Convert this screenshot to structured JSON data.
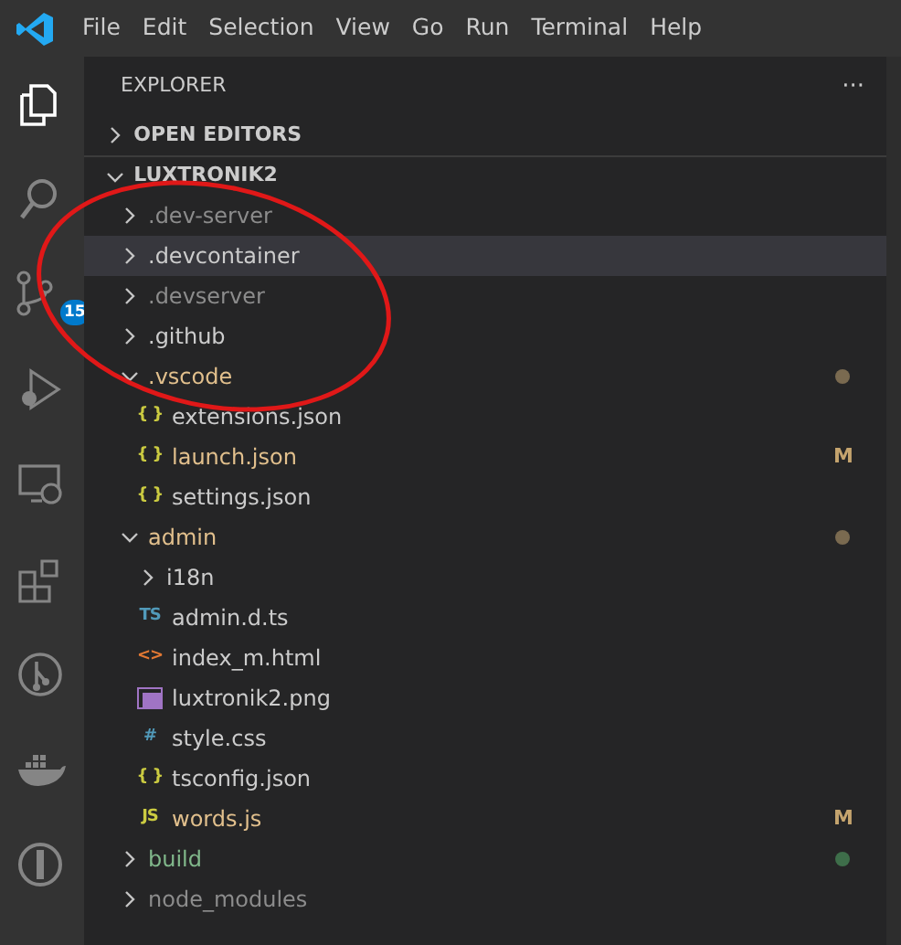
{
  "menu_bar": {
    "items": [
      "File",
      "Edit",
      "Selection",
      "View",
      "Go",
      "Run",
      "Terminal",
      "Help"
    ]
  },
  "activity_bar": [
    {
      "kind": "explorer",
      "selected": true
    },
    {
      "kind": "search",
      "selected": false
    },
    {
      "kind": "source-control",
      "selected": false,
      "badge": "15"
    },
    {
      "kind": "debug",
      "selected": false
    },
    {
      "kind": "remote",
      "selected": false
    },
    {
      "kind": "extensions",
      "selected": false
    },
    {
      "kind": "git-graph",
      "selected": false
    },
    {
      "kind": "docker",
      "selected": false
    },
    {
      "kind": "timeline",
      "selected": false
    }
  ],
  "sidebar": {
    "title": "EXPLORER",
    "more": "···",
    "sections": [
      {
        "title": "OPEN EDITORS",
        "expanded": false
      },
      {
        "title": "LUXTRONIK2",
        "expanded": true
      }
    ]
  },
  "tree": [
    {
      "name": ".dev-server",
      "kind": "folder",
      "expanded": false,
      "selected": false,
      "ignored": true
    },
    {
      "name": ".devcontainer",
      "kind": "folder",
      "expanded": false,
      "selected": true,
      "ignored": false
    },
    {
      "name": ".devserver",
      "kind": "folder",
      "expanded": false,
      "selected": false,
      "ignored": true
    },
    {
      "name": ".github",
      "kind": "folder",
      "expanded": false,
      "selected": false,
      "ignored": false
    },
    {
      "name": ".vscode",
      "kind": "folder",
      "expanded": true,
      "selected": false,
      "ignored": false,
      "color": "#e2c08d",
      "dot": {
        "color": "#7a6a50"
      },
      "children": [
        {
          "name": "extensions.json",
          "kind": "json",
          "icon": "{ }",
          "selected": false,
          "ignored": false
        },
        {
          "name": "launch.json",
          "kind": "json",
          "icon": "{ }",
          "selected": false,
          "ignored": false,
          "color": "#e2c08d",
          "status": "M"
        },
        {
          "name": "settings.json",
          "kind": "json",
          "icon": "{ }",
          "selected": false,
          "ignored": false
        }
      ]
    },
    {
      "name": "admin",
      "kind": "folder",
      "expanded": true,
      "selected": false,
      "ignored": false,
      "color": "#e2c08d",
      "dot": {
        "color": "#7a6a50"
      },
      "children": [
        {
          "name": "i18n",
          "kind": "folder",
          "expanded": false,
          "selected": false,
          "ignored": false
        },
        {
          "name": "admin.d.ts",
          "kind": "ts",
          "icon": "TS",
          "selected": false,
          "ignored": false
        },
        {
          "name": "index_m.html",
          "kind": "html",
          "icon": "<>",
          "selected": false,
          "ignored": false
        },
        {
          "name": "luxtronik2.png",
          "kind": "image",
          "selected": false,
          "ignored": false
        },
        {
          "name": "style.css",
          "kind": "css",
          "icon": "#",
          "selected": false,
          "ignored": false
        },
        {
          "name": "tsconfig.json",
          "kind": "json",
          "icon": "{ }",
          "selected": false,
          "ignored": false
        },
        {
          "name": "words.js",
          "kind": "js",
          "icon": "JS",
          "selected": false,
          "ignored": false,
          "color": "#e2c08d",
          "status": "M"
        }
      ]
    },
    {
      "name": "build",
      "kind": "folder",
      "expanded": false,
      "selected": false,
      "ignored": false,
      "color": "#81b88b",
      "dot": {
        "color": "#3e6e4a"
      }
    },
    {
      "name": "node_modules",
      "kind": "folder",
      "expanded": false,
      "selected": false,
      "ignored": true
    }
  ],
  "annotations": [
    {
      "kind": "ellipse",
      "color": "#e01818"
    }
  ]
}
